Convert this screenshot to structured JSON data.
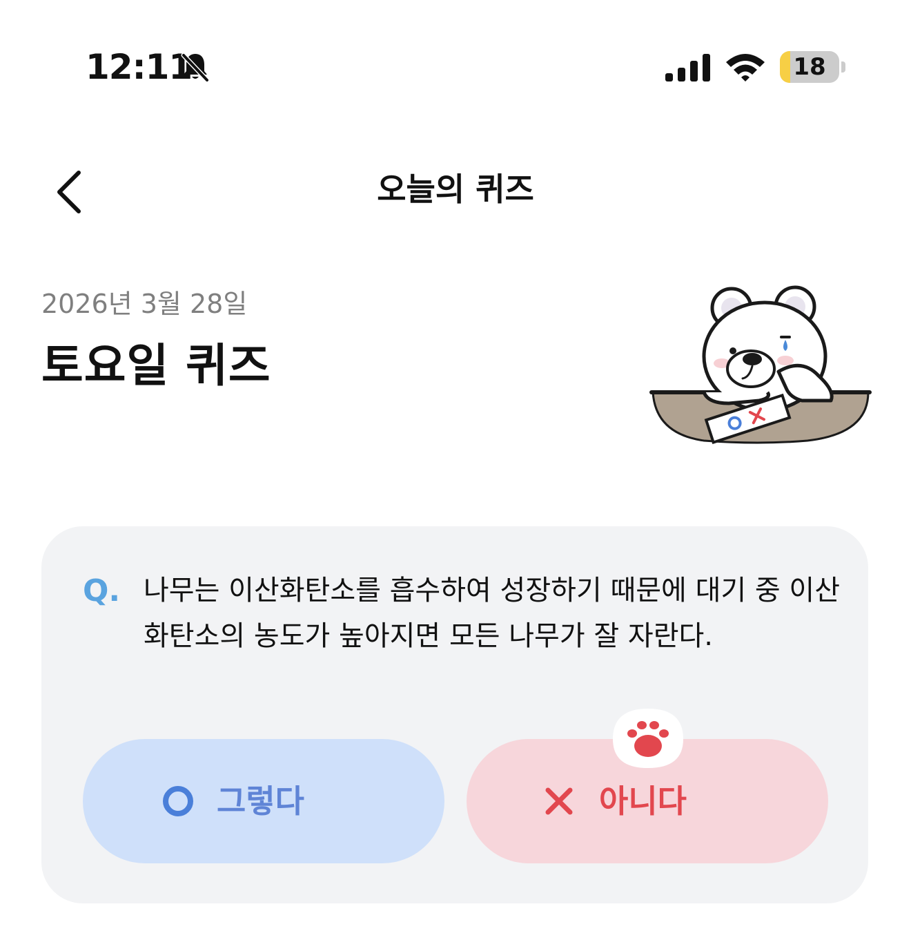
{
  "status_bar": {
    "time": "12:11",
    "battery_level": "18",
    "battery_fraction": 0.18
  },
  "icons": {
    "bell": "bell-off-icon",
    "signal": "cellular-signal-icon",
    "wifi": "wifi-icon",
    "back": "chevron-left-icon",
    "bear": "bear-mascot-illustration",
    "paw": "paw-icon",
    "circle": "circle-o-icon",
    "cross": "x-icon"
  },
  "header": {
    "title": "오늘의 퀴즈"
  },
  "quiz": {
    "date": "2026년 3월 28일",
    "title": "토요일 퀴즈",
    "q_label": "Q.",
    "question": "나무는 이산화탄소를 흡수하여 성장하기 때문에 대기 중 이산화탄소의 농도가 높아지면 모든 나무가 잘 자란다.",
    "answers": {
      "true_label": "그렇다",
      "false_label": "아니다"
    },
    "paper_marks": [
      "O",
      "X"
    ]
  },
  "colors": {
    "card_bg": "#f2f3f5",
    "true_bg": "#cfe0fa",
    "true_fg": "#5f84d6",
    "false_bg": "#f7d6db",
    "false_fg": "#e2474e",
    "q_label": "#5aa3df",
    "date": "#7f7f7f",
    "battery": "#f7cf45"
  }
}
